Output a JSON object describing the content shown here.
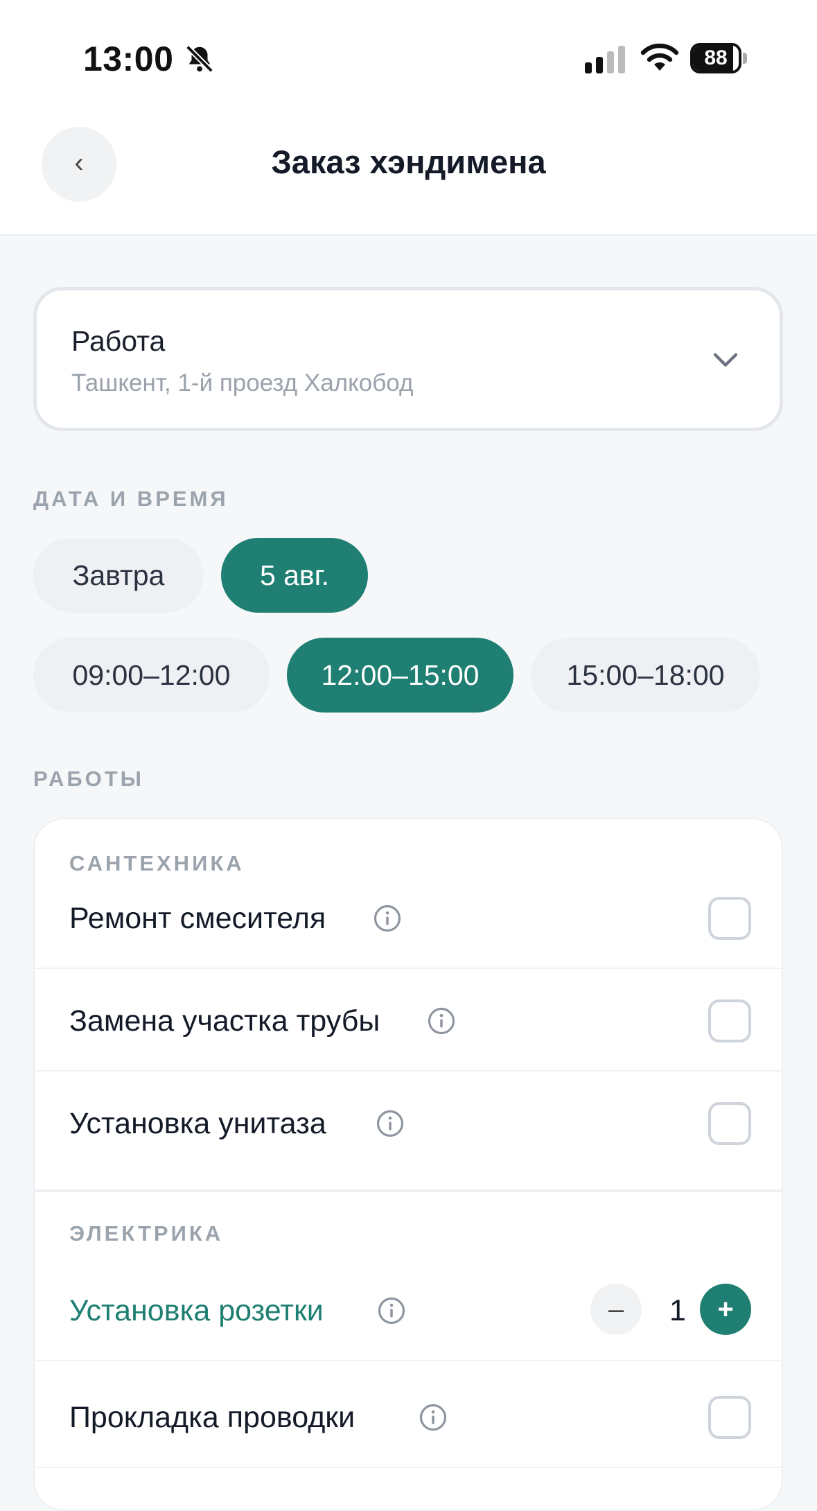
{
  "status_bar": {
    "time": "13:00",
    "battery_level": "88",
    "icons": [
      "bell-off-icon",
      "cellular-signal-icon",
      "wifi-icon",
      "battery-icon"
    ]
  },
  "header": {
    "title": "Заказ хэндимена",
    "back_icon": "‹"
  },
  "address": {
    "name": "Работа",
    "line": "Ташкент, 1-й проезд Халкобод"
  },
  "datetime": {
    "section_label": "ДАТА И ВРЕМЯ",
    "days": [
      {
        "label": "Завтра",
        "selected": false
      },
      {
        "label": "5 авг.",
        "selected": true
      }
    ],
    "slots": [
      {
        "label": "09:00–12:00",
        "selected": false
      },
      {
        "label": "12:00–15:00",
        "selected": true
      },
      {
        "label": "15:00–18:00",
        "selected": false
      }
    ]
  },
  "works": {
    "section_label": "РАБОТЫ",
    "groups": [
      {
        "label": "САНТЕХНИКА",
        "items": [
          {
            "label": "Ремонт смесителя",
            "checked": false
          },
          {
            "label": "Замена участка трубы",
            "checked": false
          },
          {
            "label": "Установка унитаза",
            "checked": false
          }
        ]
      },
      {
        "label": "ЭЛЕКТРИКА",
        "items": [
          {
            "label": "Установка розетки",
            "quantity": "1",
            "minus": "–",
            "plus": "+"
          },
          {
            "label": "Прокладка проводки",
            "checked": false
          }
        ]
      }
    ]
  },
  "colors": {
    "accent": "#1f7f72",
    "chip_bg": "#eef0f3",
    "page_bg": "#f5f7f9",
    "muted_text": "#9ba3ad"
  }
}
